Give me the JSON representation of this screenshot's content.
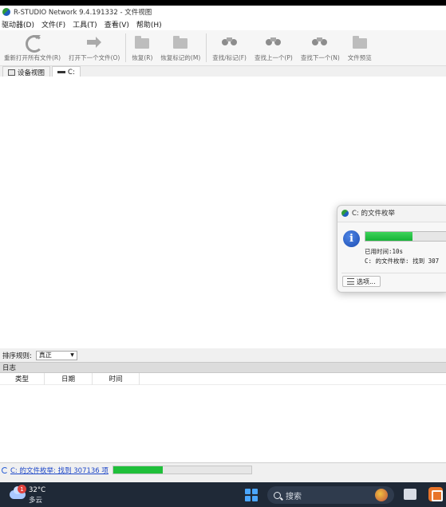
{
  "window": {
    "title": "R-STUDIO Network 9.4.191332 - 文件视图"
  },
  "menu": [
    "驱动器(D)",
    "文件(F)",
    "工具(T)",
    "查看(V)",
    "帮助(H)"
  ],
  "toolbar": {
    "reopen_label": "重新打开所有文件(R)",
    "open_next_label": "打开下一个文件(O)",
    "recover_label": "恢复(R)",
    "recover_marked_label": "恢复标记的(M)",
    "find_mark_label": "查找/标记(F)",
    "find_prev_label": "查找上一个(P)",
    "find_next_label": "查找下一个(N)",
    "file_preview_label": "文件预览"
  },
  "tabs": {
    "device_view": "设备视图",
    "drive": "C:"
  },
  "sort": {
    "label": "排序规则:",
    "value": "真正"
  },
  "log": {
    "header": "日志",
    "columns": [
      "类型",
      "日期",
      "时间"
    ]
  },
  "status": {
    "text": "C: 的文件枚举: 找到 307136 项",
    "progress": 0.36
  },
  "dialog": {
    "title": "C: 的文件枚举",
    "elapsed": "已用时间:10s",
    "detail": "C: 的文件枚举: 找到 307",
    "options_label": "选项...",
    "progress": 0.55
  },
  "taskbar": {
    "temperature": "32°C",
    "condition": "多云",
    "badge": "1",
    "search_placeholder": "搜索"
  }
}
